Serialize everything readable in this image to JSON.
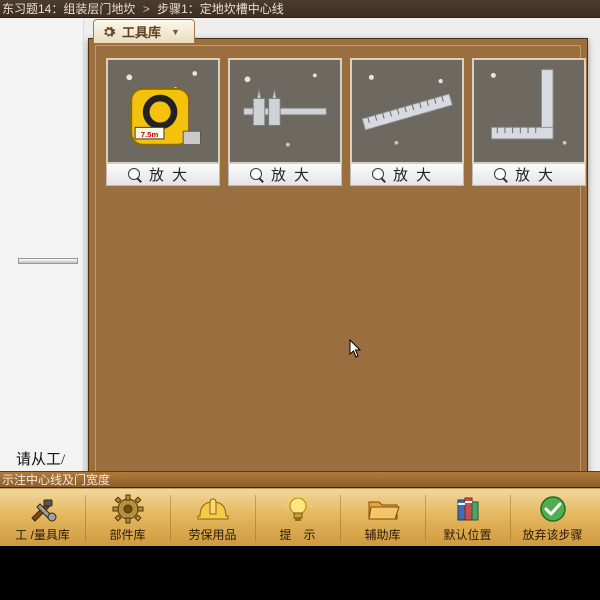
{
  "breadcrumb": {
    "part1": "东习题14：组装层门地坎",
    "sep": ">",
    "part2": "步骤1：定地坎槽中心线"
  },
  "panel": {
    "tab_label": "工具库",
    "tools": [
      {
        "name": "tape-measure",
        "zoom_label": "放大"
      },
      {
        "name": "vernier-caliper",
        "zoom_label": "放大"
      },
      {
        "name": "steel-ruler",
        "zoom_label": "放大"
      },
      {
        "name": "carpenter-square",
        "zoom_label": "放大"
      }
    ]
  },
  "stage_prompt": "请从工/",
  "task_text": "示注中心线及门宽度",
  "toolbar": [
    {
      "id": "library",
      "label": "工 /量具库"
    },
    {
      "id": "parts",
      "label": "部件库"
    },
    {
      "id": "ppe",
      "label": "劳保用品"
    },
    {
      "id": "hint",
      "label": "提　示"
    },
    {
      "id": "aux",
      "label": "辅助库"
    },
    {
      "id": "default-pos",
      "label": "默认位置"
    },
    {
      "id": "abort",
      "label": "放弃该步骤"
    }
  ],
  "colors": {
    "panel_bg": "#9b6e3f",
    "toolbar_grad_top": "#f1d79e",
    "toolbar_grad_bot": "#cf9a3f"
  }
}
